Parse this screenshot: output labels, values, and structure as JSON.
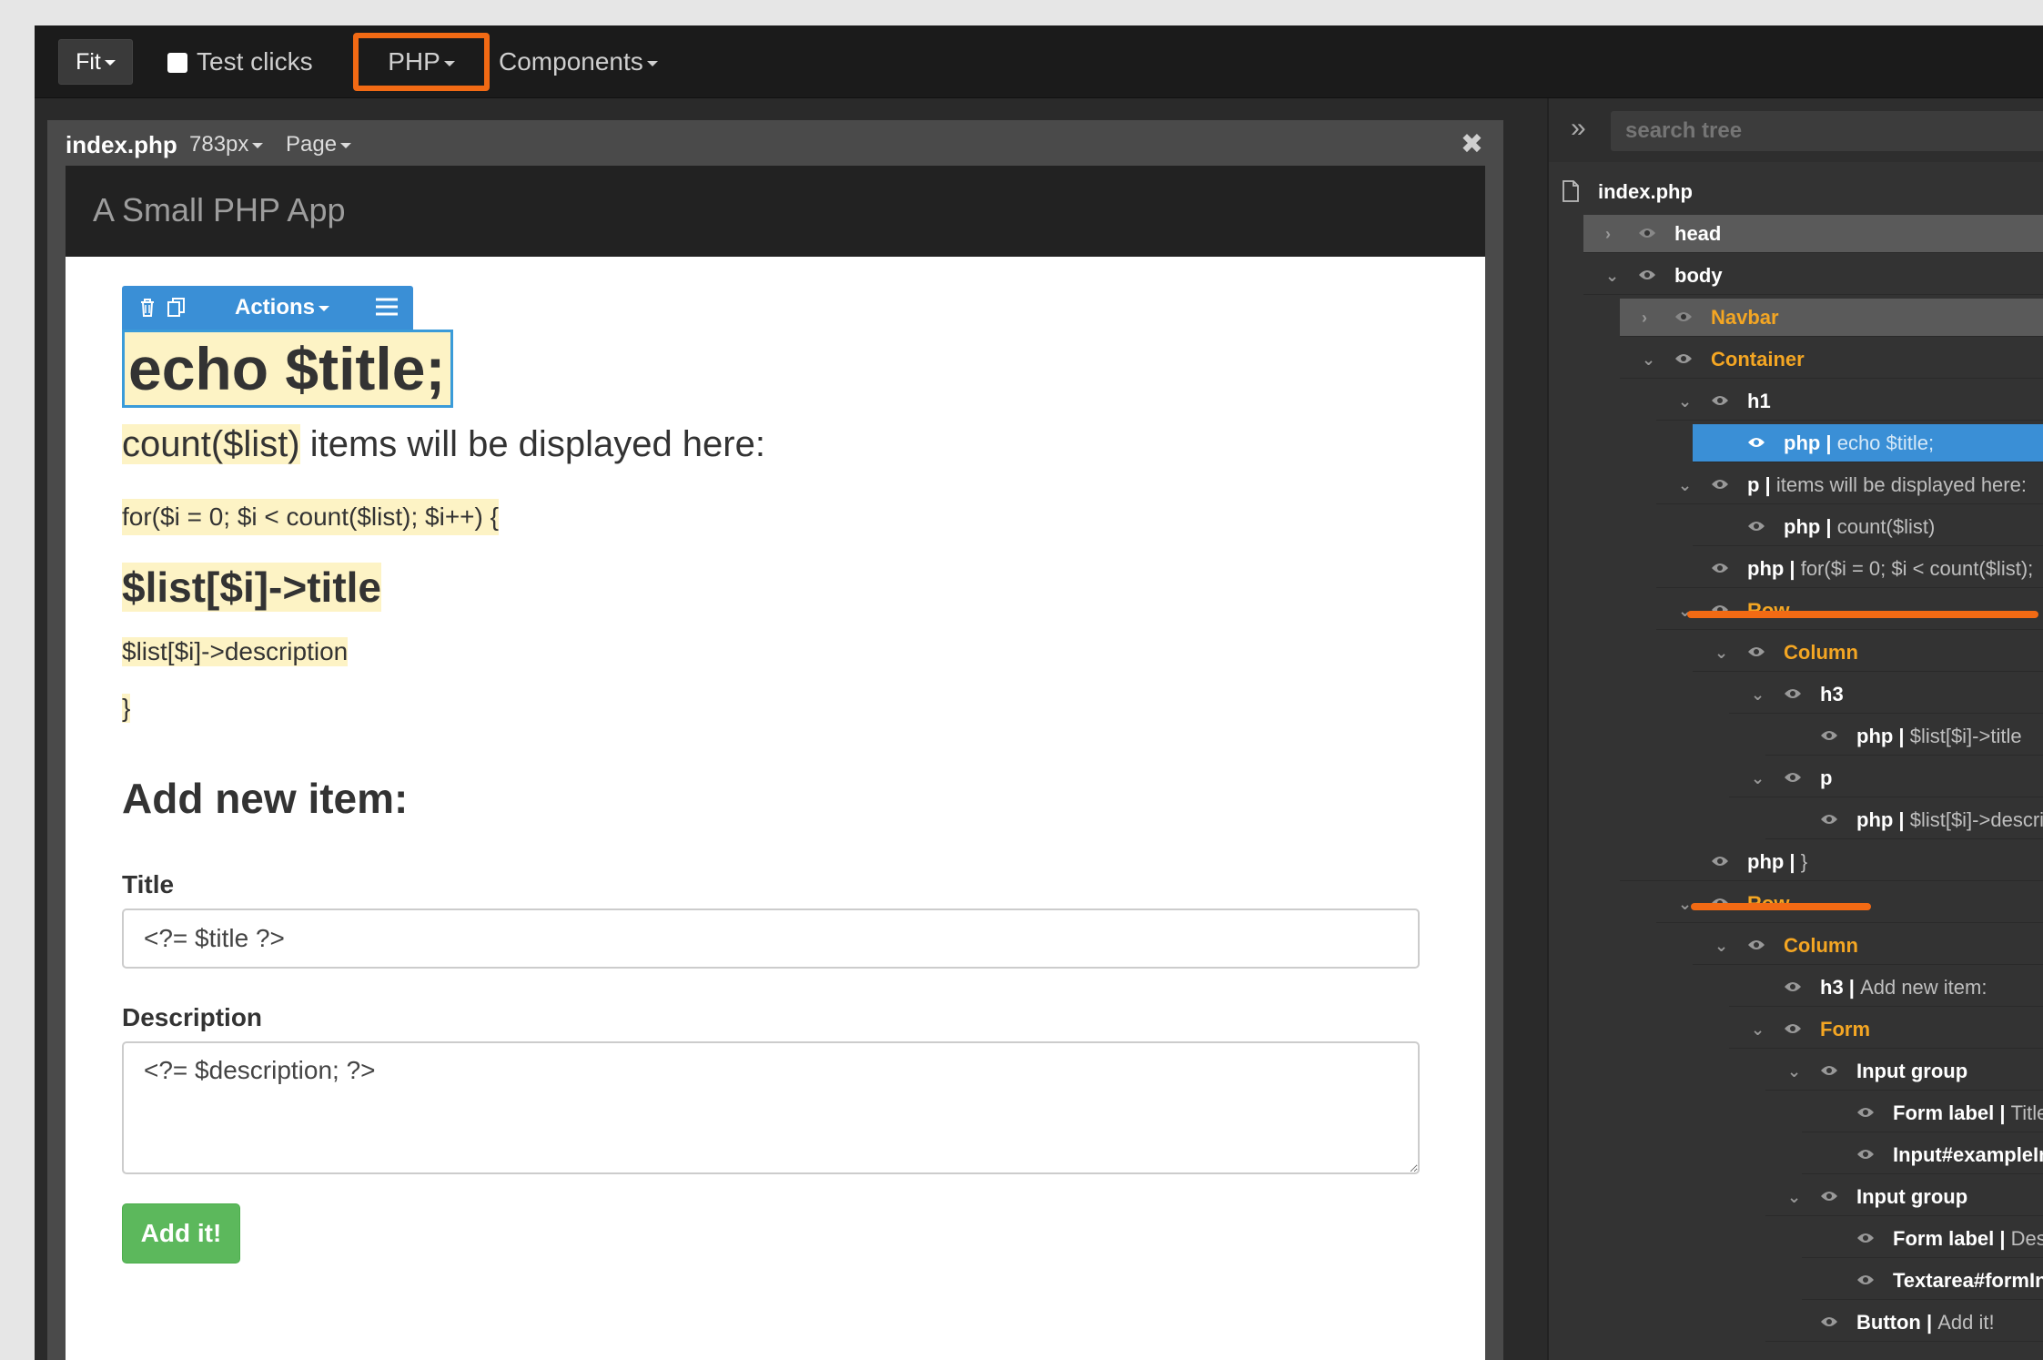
{
  "topbar": {
    "fit_label": "Fit",
    "test_clicks_label": "Test clicks",
    "php_label": "PHP",
    "components_label": "Components"
  },
  "editor": {
    "file_name": "index.php",
    "width_label": "783px",
    "page_label": "Page",
    "close_glyph": "✖"
  },
  "canvas": {
    "brand": "A Small PHP App",
    "toolbar_actions": "Actions",
    "h1": "echo $title;",
    "p_php": "count($list)",
    "p_text": " items will be displayed here:",
    "for_line": "for($i = 0; $i < count($list); $i++) {",
    "h3_title": "$list[$i]->title",
    "description": "$list[$i]->description",
    "closing_brace": "}",
    "h3_add": "Add new item:",
    "title_label": "Title",
    "title_value": "<?= $title ?>",
    "description_label": "Description",
    "description_value": "<?= $description; ?>",
    "button_label": "Add it!"
  },
  "panel": {
    "search_placeholder": "search tree",
    "expand_glyph": "»",
    "root": "index.php"
  },
  "tree": [
    {
      "label": "head",
      "sub": ""
    },
    {
      "label": "body",
      "sub": ""
    },
    {
      "label": "Navbar",
      "sub": ""
    },
    {
      "label": "Container",
      "sub": ""
    },
    {
      "label": "h1",
      "sub": ""
    },
    {
      "label": "php | ",
      "sub": "echo $title;"
    },
    {
      "label": "p | ",
      "sub": "items will be displayed here:"
    },
    {
      "label": "php | ",
      "sub": "count($list)"
    },
    {
      "label": "php | ",
      "sub": "for($i = 0; $i < count($list);"
    },
    {
      "label": "Row",
      "sub": ""
    },
    {
      "label": "Column",
      "sub": ""
    },
    {
      "label": "h3",
      "sub": ""
    },
    {
      "label": "php | ",
      "sub": "$list[$i]->title"
    },
    {
      "label": "p",
      "sub": ""
    },
    {
      "label": "php | ",
      "sub": "$list[$i]->descri"
    },
    {
      "label": "php | ",
      "sub": "}"
    },
    {
      "label": "Row",
      "sub": ""
    },
    {
      "label": "Column",
      "sub": ""
    },
    {
      "label": "h3 | ",
      "sub": "Add new item:"
    },
    {
      "label": "Form",
      "sub": ""
    },
    {
      "label": "Input group",
      "sub": ""
    },
    {
      "label": "Form label | ",
      "sub": "Title"
    },
    {
      "label": "Input#exampleIn",
      "sub": ""
    },
    {
      "label": "Input group",
      "sub": ""
    },
    {
      "label": "Form label | ",
      "sub": "Desc"
    },
    {
      "label": "Textarea#formInp",
      "sub": ""
    },
    {
      "label": "Button | ",
      "sub": "Add it!"
    }
  ],
  "colors": {
    "accent_orange": "#f26a14",
    "selection_blue": "#3a8fd6",
    "php_highlight": "#fdf3c5",
    "success_green": "#5cb85c",
    "component_label": "#f4a623"
  }
}
